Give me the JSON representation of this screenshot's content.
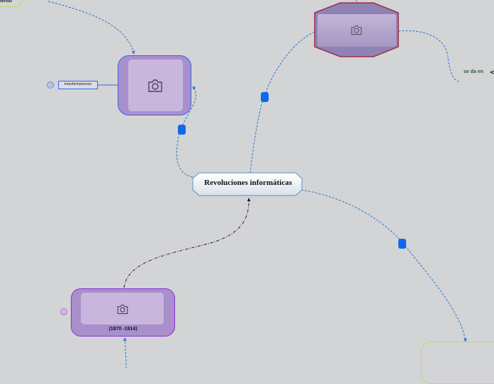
{
  "map": {
    "central_topic": "Revoluciones informáticas",
    "top_left_fragment": "iento",
    "side_topic": "transformaciones",
    "period_label": "(1870 -1914)",
    "relation_label": "se da en"
  },
  "icons": {
    "image_placeholder": "camera-icon",
    "collapse": "collapse-circle-icon"
  },
  "colors": {
    "background": "#d3d4d5",
    "node_fill": "#a98fcc",
    "node_inner": "#c8b6dd",
    "blue_border": "#2f69e8",
    "purple_border": "#8c2fd8",
    "hex_border": "#a0304a",
    "green_border": "#b6dc6a",
    "connector_blue": "#2a74d8",
    "connector_black": "#1a1a2a",
    "handle": "#1168e8"
  }
}
